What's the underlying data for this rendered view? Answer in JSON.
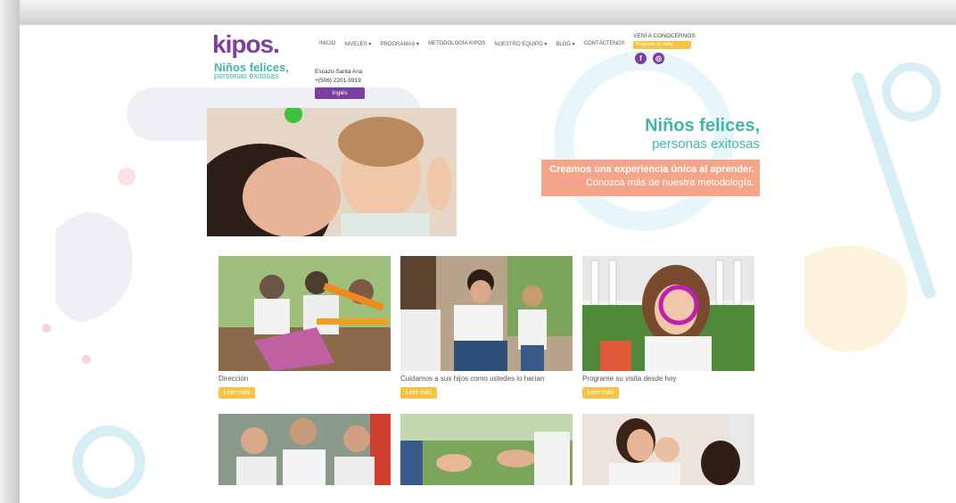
{
  "header": {
    "logo": "kipos.",
    "tagline_line1": "Niños felices,",
    "tagline_line2": "personas exitosas",
    "nav": [
      "INICIO",
      "NIVELES ▾",
      "PROGRAMAS ▾",
      "METODOLOGÍA KIPOS",
      "NUESTRO EQUIPO ▾",
      "BLOG ▾",
      "CONTÁCTENOS"
    ],
    "cta_title": "VENÍ A CONOCERNOS",
    "whatsapp_label": "Programe su visita",
    "location": "Escazú-Santa Ana",
    "phone": "+(506) 2201-5919",
    "language_button": "Inglés"
  },
  "hero": {
    "title": "Niños felices,",
    "subtitle": "personas exitosas",
    "box_line1": "Creamos una experiencia única al aprender.",
    "box_line2": "Conozca más de nuestra metodología."
  },
  "cards": [
    {
      "caption": "Dirección",
      "button": "Leer más"
    },
    {
      "caption": "Cuidamos a sus hijos como ustedes lo harían",
      "button": "Leer más"
    },
    {
      "caption": "Programe su visita desde hoy",
      "button": "Leer más"
    }
  ],
  "colors": {
    "brand_purple": "#7b3fa0",
    "teal": "#3fb8a5",
    "yellow": "#f6c343",
    "peach": "#f4a58a"
  }
}
